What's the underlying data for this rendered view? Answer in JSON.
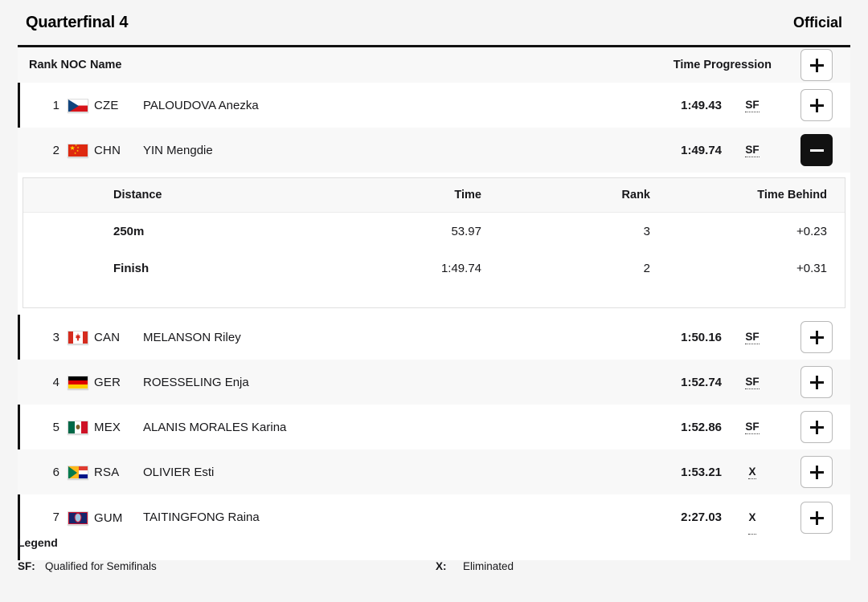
{
  "header": {
    "title": "Quarterfinal 4",
    "status": "Official"
  },
  "table": {
    "columns": {
      "rank_noc": "Rank NOC",
      "name": "Name",
      "time_progression": "Time Progression",
      "expand_icon": "plus-icon"
    },
    "rows": [
      {
        "rank": "1",
        "noc": "CZE",
        "flag": "cze-flag",
        "name": "PALOUDOVA Anezka",
        "time": "1:49.43",
        "progression": "SF",
        "expanded": false,
        "toggle_icon": "plus-icon"
      },
      {
        "rank": "2",
        "noc": "CHN",
        "flag": "chn-flag",
        "name": "YIN Mengdie",
        "time": "1:49.74",
        "progression": "SF",
        "expanded": true,
        "toggle_icon": "minus-icon"
      },
      {
        "rank": "3",
        "noc": "CAN",
        "flag": "can-flag",
        "name": "MELANSON Riley",
        "time": "1:50.16",
        "progression": "SF",
        "expanded": false,
        "toggle_icon": "plus-icon"
      },
      {
        "rank": "4",
        "noc": "GER",
        "flag": "ger-flag",
        "name": "ROESSELING Enja",
        "time": "1:52.74",
        "progression": "SF",
        "expanded": false,
        "toggle_icon": "plus-icon"
      },
      {
        "rank": "5",
        "noc": "MEX",
        "flag": "mex-flag",
        "name": "ALANIS MORALES Karina",
        "time": "1:52.86",
        "progression": "SF",
        "expanded": false,
        "toggle_icon": "plus-icon"
      },
      {
        "rank": "6",
        "noc": "RSA",
        "flag": "rsa-flag",
        "name": "OLIVIER Esti",
        "time": "1:53.21",
        "progression": "X",
        "expanded": false,
        "toggle_icon": "plus-icon"
      },
      {
        "rank": "7",
        "noc": "GUM",
        "flag": "gum-flag",
        "name": "TAITINGFONG Raina",
        "time": "2:27.03",
        "progression": "X",
        "expanded": false,
        "toggle_icon": "plus-icon"
      }
    ]
  },
  "split_detail": {
    "columns": {
      "distance": "Distance",
      "time": "Time",
      "rank": "Rank",
      "time_behind": "Time Behind"
    },
    "rows": [
      {
        "distance": "250m",
        "time": "53.97",
        "rank": "3",
        "time_behind": "+0.23"
      },
      {
        "distance": "Finish",
        "time": "1:49.74",
        "rank": "2",
        "time_behind": "+0.31"
      }
    ]
  },
  "legend": {
    "title": "Legend",
    "entries": [
      {
        "key": "SF:",
        "value": "Qualified for Semifinals"
      },
      {
        "key": "X:",
        "value": "Eliminated"
      }
    ]
  }
}
